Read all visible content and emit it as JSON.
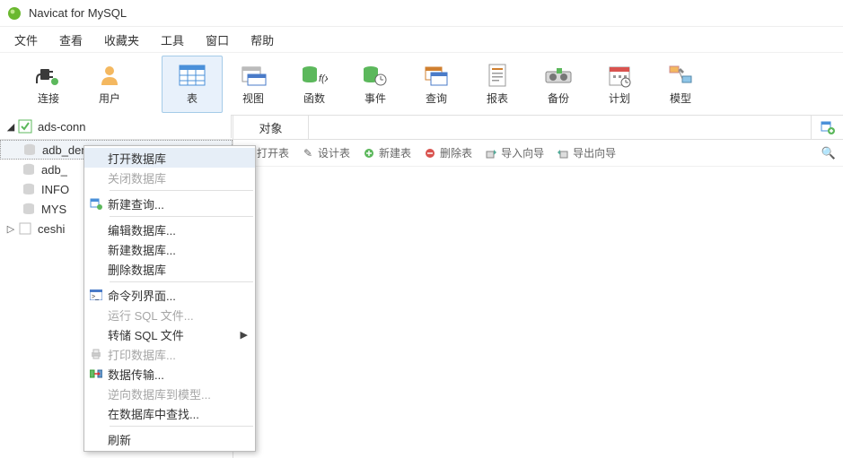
{
  "app": {
    "title": "Navicat for MySQL"
  },
  "menubar": [
    "文件",
    "查看",
    "收藏夹",
    "工具",
    "窗口",
    "帮助"
  ],
  "toolbar": [
    {
      "id": "connect",
      "label": "连接"
    },
    {
      "id": "user",
      "label": "用户"
    },
    {
      "id": "table",
      "label": "表",
      "active": true
    },
    {
      "id": "view",
      "label": "视图"
    },
    {
      "id": "function",
      "label": "函数"
    },
    {
      "id": "event",
      "label": "事件"
    },
    {
      "id": "query",
      "label": "查询"
    },
    {
      "id": "report",
      "label": "报表"
    },
    {
      "id": "backup",
      "label": "备份"
    },
    {
      "id": "schedule",
      "label": "计划"
    },
    {
      "id": "model",
      "label": "模型"
    }
  ],
  "tabs": {
    "object": "对象"
  },
  "tree": {
    "conn": "ads-conn",
    "items": [
      {
        "label": "adb_demo",
        "selected": true
      },
      {
        "label": "adb_"
      },
      {
        "label": "INFO"
      },
      {
        "label": "MYS"
      }
    ],
    "conn2": "ceshi"
  },
  "actionbar": {
    "open": "打开表",
    "design": "设计表",
    "new": "新建表",
    "delete": "删除表",
    "import": "导入向导",
    "export": "导出向导"
  },
  "ctx": {
    "open_db": "打开数据库",
    "close_db": "关闭数据库",
    "new_query": "新建查询...",
    "edit_db": "编辑数据库...",
    "new_db": "新建数据库...",
    "delete_db": "删除数据库",
    "cmdline": "命令列界面...",
    "run_sql": "运行 SQL 文件...",
    "dump_sql": "转储 SQL 文件",
    "print_db": "打印数据库...",
    "data_transfer": "数据传输...",
    "reverse": "逆向数据库到模型...",
    "find_in_db": "在数据库中查找...",
    "refresh": "刷新"
  }
}
